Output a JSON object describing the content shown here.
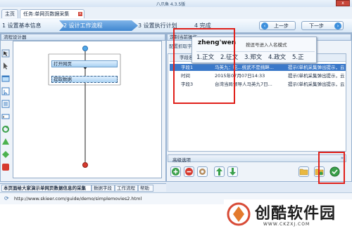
{
  "window": {
    "title": "八爪鱼 4.3.5版",
    "close_label": "x"
  },
  "tabs": [
    {
      "label": "主页"
    },
    {
      "label": "任务:单网页数据采集demo"
    }
  ],
  "steps": [
    {
      "num": "1",
      "label": "设置基本信息"
    },
    {
      "num": "2",
      "label": "设计工作流程"
    },
    {
      "num": "3",
      "label": "设置执行计划"
    },
    {
      "num": "4",
      "label": "完成"
    }
  ],
  "nav": {
    "prev_label": "上一步",
    "next_label": "下一步",
    "prev_icon": "arrow-left-icon",
    "next_icon": "arrow-right-icon"
  },
  "designer": {
    "header": "流程设计器",
    "nodes": [
      {
        "label": "打开网页"
      },
      {
        "label": "提取数据"
      }
    ]
  },
  "field_panel": {
    "header": "定制当前操作",
    "subheader": "配置抓取字段",
    "column_header": "字段名",
    "rows": [
      {
        "type": "TT",
        "name": "字段1",
        "value": "马英九：吃...统武不是挑衅...",
        "extra": "提示(单机采集弹出提示，云..."
      },
      {
        "type": "TT",
        "name": "时间",
        "value": "2015年07月07日14:33",
        "extra": "提示(单机采集弹出提示，云..."
      },
      {
        "type": "TT",
        "name": "字段3",
        "value": "台湾当局领导人马英九7日...",
        "extra": "提示(单机采集弹出提示，云..."
      }
    ],
    "advanced_label": "高级选项",
    "expand_icon": "double-chevron-down-icon"
  },
  "ime": {
    "input_text": "zheng'wen",
    "hint": "按逗号进入人名模式",
    "candidates": [
      "1.正文",
      "2.征文",
      "3.郑文",
      "4.政文",
      "5.正"
    ]
  },
  "toolbar_icons": [
    "add-icon",
    "remove-icon",
    "settings-icon",
    "move-up-icon",
    "move-down-icon",
    "folder-icon",
    "save-icon",
    "confirm-icon"
  ],
  "bottom_tabs": [
    {
      "label": "本页面给大家演示单网页数据信息的采集"
    },
    {
      "label": "数据字段"
    },
    {
      "label": "工作流程"
    },
    {
      "label": "帮助"
    }
  ],
  "url": "http://www.skieer.com/guide/demo/simplemovies2.html",
  "watermark": {
    "name": "创酷软件园",
    "site": "WWW.CKZXJ.COM"
  },
  "colors": {
    "accent": "#3f86d0",
    "selection": "#3a78c9",
    "highlight": "#e0201a"
  }
}
